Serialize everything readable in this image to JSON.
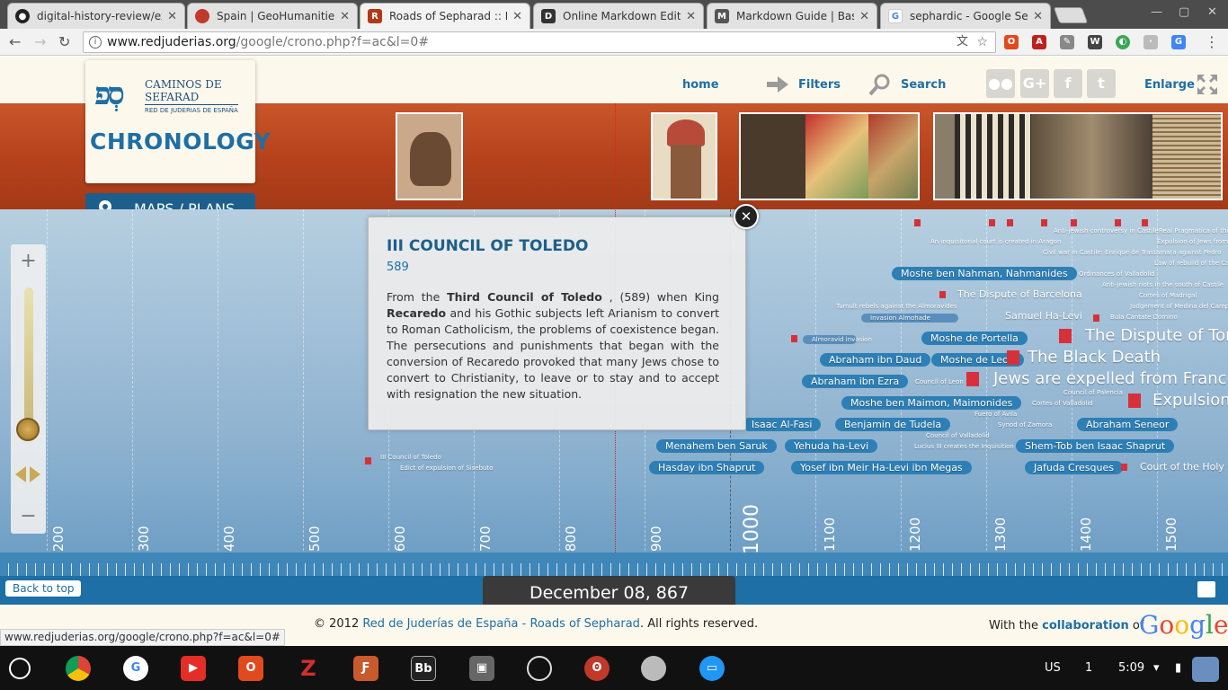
{
  "browser": {
    "tabs": [
      {
        "title": "digital-history-review/ex",
        "favicon": "github-icon"
      },
      {
        "title": "Spain | GeoHumanities",
        "favicon": "geohumanities-icon"
      },
      {
        "title": "Roads of Sepharad :: Ne",
        "favicon": "sepharad-icon"
      },
      {
        "title": "Online Markdown Editor",
        "favicon": "dillinger-icon"
      },
      {
        "title": "Markdown Guide | Basic",
        "favicon": "markdown-icon"
      },
      {
        "title": "sephardic - Google Sear",
        "favicon": "google-icon"
      }
    ],
    "url_domain": "www.redjuderias.org",
    "url_path": "/google/crono.php?f=ac&l=0#",
    "status_url": "www.redjuderias.org/google/crono.php?f=ac&l=0#"
  },
  "site": {
    "logo_line1": "CAMINOS DE",
    "logo_line2": "SEFARAD",
    "logo_sub": "RED DE JUDERIAS DE ESPAÑA",
    "section_title": "CHRONOLOGY",
    "maps_label": "MAPS / PLANS",
    "nav": {
      "home": "home",
      "filters": "Filters",
      "search": "Search",
      "enlarge": "Enlarge"
    }
  },
  "timeline": {
    "years": [
      "200",
      "300",
      "400",
      "500",
      "600",
      "700",
      "800",
      "900",
      "1000",
      "1100",
      "1200",
      "1300",
      "1400",
      "1500"
    ],
    "events": [
      {
        "label": "Moshe ben Nahman, Nahmanides",
        "style": "pill"
      },
      {
        "label": "The Dispute of Barcelona",
        "style": "normal"
      },
      {
        "label": "Samuel Ha-Levi",
        "style": "normal"
      },
      {
        "label": "The Dispute of Tort",
        "style": "big"
      },
      {
        "label": "Moshe de Portella",
        "style": "pill"
      },
      {
        "label": "Abraham ibn Daud",
        "style": "pill"
      },
      {
        "label": "Moshe de Leon",
        "style": "pill"
      },
      {
        "label": "The Black Death",
        "style": "big"
      },
      {
        "label": "Abraham ibn Ezra",
        "style": "pill"
      },
      {
        "label": "Jews are expelled from France",
        "style": "big"
      },
      {
        "label": "Moshe ben Maimon, Maimonides",
        "style": "pill"
      },
      {
        "label": "Expulsion",
        "style": "big"
      },
      {
        "label": "Isaac Al-Fasi",
        "style": "pill"
      },
      {
        "label": "Benjamin de Tudela",
        "style": "pill"
      },
      {
        "label": "Abraham Seneor",
        "style": "pill"
      },
      {
        "label": "Menahem ben Saruk",
        "style": "pill"
      },
      {
        "label": "Yehuda ha-Levi",
        "style": "pill"
      },
      {
        "label": "Shem-Tob ben Isaac Shaprut",
        "style": "pill"
      },
      {
        "label": "Hasday ibn Shaprut",
        "style": "pill"
      },
      {
        "label": "Yosef ibn Meir Ha-Levi ibn Megas",
        "style": "pill"
      },
      {
        "label": "Jafuda Cresques",
        "style": "pill"
      },
      {
        "label": "Court of the Holy Of",
        "style": "normal"
      },
      {
        "label": "III Council of Toledo",
        "style": "small"
      },
      {
        "label": "Edict of expulsion of Sisebuto",
        "style": "small"
      },
      {
        "label": "An inquisitorial court is created in Aragon",
        "style": "small"
      },
      {
        "label": "Civil war in Castile: Enrique de Trastamara against Pedro",
        "style": "small"
      },
      {
        "label": "Anti-jewish controversy in Castile",
        "style": "small"
      },
      {
        "label": "Real Pragmatica of the Catholic",
        "style": "small"
      },
      {
        "label": "Expulsion of Jews from P",
        "style": "small"
      },
      {
        "label": "Law of rebuild of the Cathol",
        "style": "small"
      },
      {
        "label": "Ordinances of Valladolid",
        "style": "small"
      },
      {
        "label": "Anti-jewish riots in the south of Castile",
        "style": "small"
      },
      {
        "label": "Cortes of Madrigal",
        "style": "small"
      },
      {
        "label": "Judgement of Medina del Campo",
        "style": "small"
      },
      {
        "label": "Bula Cantate Domino",
        "style": "small"
      },
      {
        "label": "Tumult rebels against the Almoravides",
        "style": "small"
      },
      {
        "label": "Invasion Almohade",
        "style": "small"
      },
      {
        "label": "Almoravid invasion",
        "style": "small"
      },
      {
        "label": "Council of Leon",
        "style": "small"
      },
      {
        "label": "Council of Palencia",
        "style": "small"
      },
      {
        "label": "Cortes of Valladolid",
        "style": "small"
      },
      {
        "label": "Fuero of Avila",
        "style": "small"
      },
      {
        "label": "Synod of Zamora",
        "style": "small"
      },
      {
        "label": "Council of Valladolid",
        "style": "small"
      },
      {
        "label": "Lucius III creates the Inquisition",
        "style": "small"
      }
    ],
    "current_date": "December 08, 867",
    "back_to_top": "Back to top"
  },
  "popup": {
    "title": "III COUNCIL OF TOLEDO",
    "year": "589",
    "text_before": "From the",
    "bold1": "Third Council of Toledo",
    "text_mid": ", (589) when King",
    "bold2": "Recaredo",
    "text_after": "and his Gothic subjects left Arianism to convert to Roman Catholicism, the problems of coexistence began. The persecutions and punishments that began with the conversion of Recaredo provoked that many Jews chose to convert to Christianity, to leave or to stay and to accept with resignation the new situation."
  },
  "footer": {
    "copyright_prefix": "© 2012",
    "copyright_link": "Red de Juderías de España - Roads of Sepharad",
    "copyright_suffix": ". All rights reserved.",
    "collab_prefix": "With the",
    "collab_link": "collaboration",
    "collab_suffix": "of",
    "google_logo": "Google"
  },
  "shelf": {
    "apps": [
      "launcher-icon",
      "chrome-icon",
      "google-icon",
      "youtube-icon",
      "office-icon",
      "zotero-icon",
      "filezilla-icon",
      "blackboard-icon",
      "vm-icon",
      "github-icon",
      "owl-icon",
      "disc-icon",
      "files-icon"
    ],
    "locale": "US",
    "notifications": "1",
    "time": "5:09"
  },
  "colors": {
    "accent": "#1d6fa5",
    "banner": "#b5411c",
    "timeline": "#a2c0d8",
    "flag": "#d8303a"
  }
}
